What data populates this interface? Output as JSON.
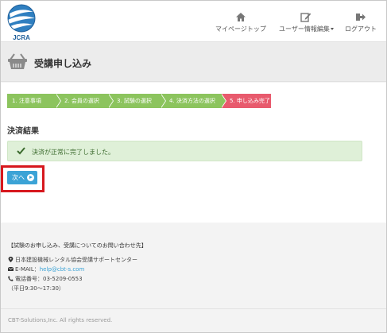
{
  "header": {
    "logo_text": "JCRA",
    "nav": {
      "mypage": "マイページトップ",
      "userinfo": "ユーザー情報編集",
      "logout": "ログアウト"
    }
  },
  "page": {
    "title": "受講申し込み"
  },
  "steps": [
    "1. 注意事項",
    "2. 会員の選択",
    "3. 試験の選択",
    "4. 決済方法の選択",
    "5. 申し込み完了"
  ],
  "result": {
    "heading": "決済結果",
    "message": "決済が正常に完了しました。"
  },
  "next_button": "次へ",
  "contact": {
    "title": "【試験のお申し込み、受講についてのお問い合わせ先】",
    "org": "日本建設機械レンタル協会受講サポートセンター",
    "email_label": "E-MAIL：",
    "email": "help@cbt-s.com",
    "tel": "電話番号：03-5209-0553",
    "hours": "（平日9:30〜17:30）"
  },
  "copyright": "CBT-Solutions,Inc. All rights reserved.",
  "colors": {
    "step_done": "#8cc45e",
    "step_current": "#e85a6d",
    "button": "#3ba3d6",
    "alert_bg": "#dff0d8",
    "highlight": "#d7181e"
  }
}
